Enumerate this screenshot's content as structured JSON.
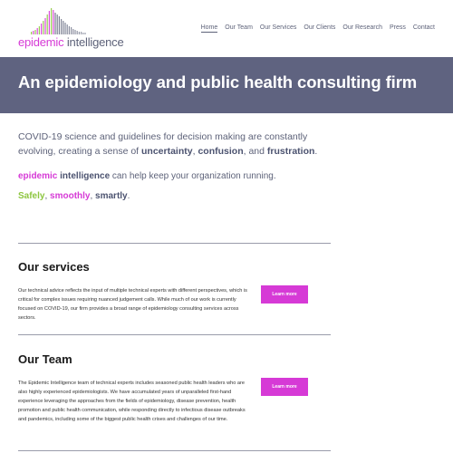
{
  "brand": {
    "name_part1": "epidemic",
    "name_part2": "intelligence",
    "colors": {
      "magenta": "#d63ad6",
      "slate": "#5d6279",
      "green": "#8dc63f",
      "hero_bg": "#5f6380"
    }
  },
  "nav": {
    "items": [
      {
        "label": "Home",
        "active": true
      },
      {
        "label": "Our Team"
      },
      {
        "label": "Our Services"
      },
      {
        "label": "Our Clients"
      },
      {
        "label": "Our Research"
      },
      {
        "label": "Press"
      },
      {
        "label": "Contact"
      }
    ]
  },
  "hero": {
    "title": "An epidemiology and public health consulting firm"
  },
  "intro": {
    "line1": "COVID-19 science and guidelines for decision making are constantly evolving, creating a sense of ",
    "w_uncertainty": "uncertainty",
    "sep1": ", ",
    "w_confusion": "confusion",
    "sep2": ", and ",
    "w_frustration": "frustration",
    "end": ".",
    "ei_part1": "epidemic",
    "ei_part2": "intelligence",
    "ei_rest": " can help keep your organization running.",
    "tag_safely": "Safely",
    "tag_sep1": ", ",
    "tag_smoothly": "smoothly",
    "tag_sep2": ", ",
    "tag_smartly": "smartly",
    "tag_end": "."
  },
  "services": {
    "title": "Our services",
    "body": "Our technical advice reflects the input of multiple technical experts with different perspectives, which is critical for complex issues requiring nuanced judgement calls. While much of our work is currently focused on COVID-19, our firm provides a broad range of epidemiology consulting services across sectors.",
    "button": "Learn more"
  },
  "team": {
    "title": "Our Team",
    "body": "The Epidemic Intelligence team of technical experts includes seasoned public health leaders who are also highly experienced epidemiologists. We have accumulated years of unparalleled first-hand experience leveraging the approaches from the fields of epidemiology, disease prevention, health promotion and public health communication, while responding directly to infectious disease outbreaks and pandemics, including some of the biggest public health crises and challenges of our time.",
    "button": "Learn more"
  }
}
